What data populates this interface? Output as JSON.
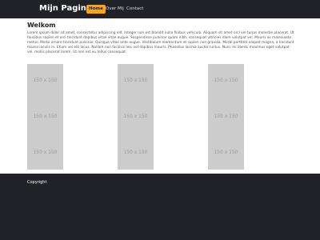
{
  "navbar": {
    "brand": "Mijn Pagina",
    "items": [
      {
        "label": "Home",
        "active": true
      },
      {
        "label": "Over Mij",
        "active": false
      },
      {
        "label": "Contact",
        "active": false
      }
    ]
  },
  "main": {
    "heading": "Welkom",
    "body": "Lorem ipsum dolor sit amet, consectetur adipiscing elit. Integer non est blandit nulla finibus vehicula. Aliquam sit amet orci vel turpis molestie placerat. Ut faucibus sapien et orci tincidunt dapibus vitae vitae augue. Suspendisse pulvinar quam nibh, consequat ultricies diam volutpat vel. Mauris ac malesuada metus. Morbi ornare tincidunt pulvinar. Quisque vitae ante augue. Vestibulum elementum et sapien non gravida. Morbi porttitor aliquet magna, a tincidunt massa iaculis in. Etiam vel elit lacus. Nullam non facilisis leo, vel dapibus mauris. Phasellus lacinia auctor luctus. Nunc mi libero, maximus eget volutpat vel, mollis placerat lorem. Ut non est eu tellus consequat.",
    "placeholders": [
      {
        "label": "150 x 150"
      },
      {
        "label": "150 x 150"
      },
      {
        "label": "150 x 150"
      }
    ]
  },
  "footer": {
    "copyright": "Copyright"
  },
  "colors": {
    "nav_bg": "#202228",
    "accent": "#f5a623",
    "placeholder_bg": "#cccccc",
    "footer_bg": "#202228"
  }
}
